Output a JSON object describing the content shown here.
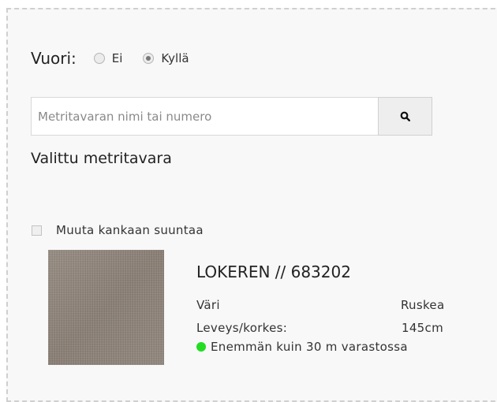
{
  "lining": {
    "label": "Vuori:",
    "options": [
      {
        "label": "Ei",
        "selected": false
      },
      {
        "label": "Kyllä",
        "selected": true
      }
    ]
  },
  "search": {
    "placeholder": "Metritavaran nimi tai numero",
    "button_icon": "search-icon"
  },
  "selected_heading": "Valittu metritavara",
  "direction_checkbox": {
    "label": "Muuta kankaan suuntaa",
    "checked": false
  },
  "product": {
    "title": "LOKEREN // 683202",
    "color_label": "Väri",
    "color_value": "Ruskea",
    "width_label": "Leveys/korkes:",
    "width_value": "145cm",
    "stock_text": "Enemmän kuin 30 m varastossa",
    "stock_color": "#22dd22",
    "swatch_color": "#8e8378"
  }
}
